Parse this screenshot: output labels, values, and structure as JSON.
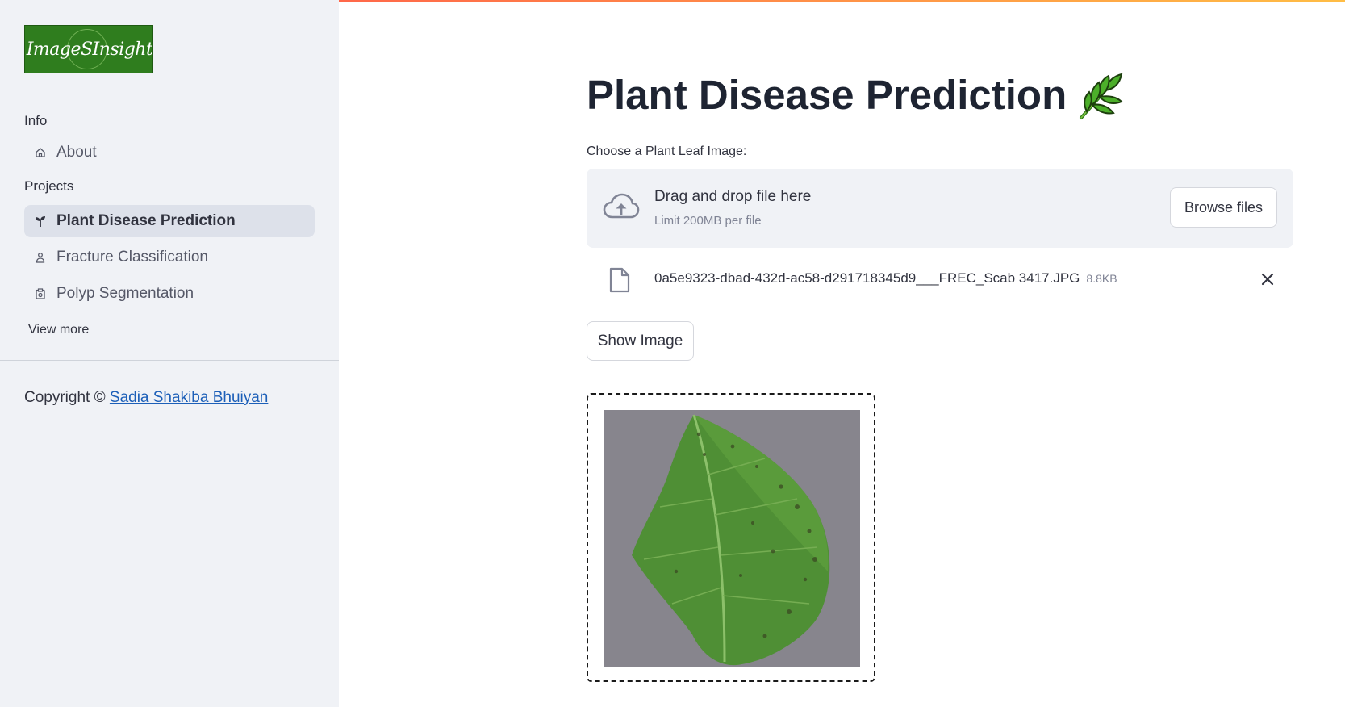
{
  "sidebar": {
    "logo_text": "ImageSInsight",
    "sections": [
      {
        "label": "Info",
        "items": [
          {
            "label": "About",
            "icon": "home-icon",
            "active": false
          }
        ]
      },
      {
        "label": "Projects",
        "items": [
          {
            "label": "Plant Disease Prediction",
            "icon": "plant-icon",
            "active": true
          },
          {
            "label": "Fracture Classification",
            "icon": "person-icon",
            "active": false
          },
          {
            "label": "Polyp Segmentation",
            "icon": "clipboard-icon",
            "active": false
          }
        ]
      }
    ],
    "view_more": "View more",
    "copyright_prefix": "Copyright ©",
    "copyright_link": "Sadia Shakiba Bhuiyan"
  },
  "main": {
    "title": "Plant Disease Prediction",
    "title_emoji": "herb-emoji",
    "uploader": {
      "label": "Choose a Plant Leaf Image:",
      "drag_text": "Drag and drop file here",
      "limit_text": "Limit 200MB per file",
      "browse_label": "Browse files"
    },
    "file": {
      "name": "0a5e9323-dbad-432d-ac58-d291718345d9___FREC_Scab 3417.JPG",
      "size": "8.8KB"
    },
    "show_image_label": "Show Image"
  },
  "colors": {
    "sidebar_bg": "#f0f2f6",
    "active_item_bg": "#dde1ea",
    "link": "#1c5fb8",
    "accent_gradient_start": "#ff4b4b",
    "accent_gradient_end": "#ffbd45"
  }
}
